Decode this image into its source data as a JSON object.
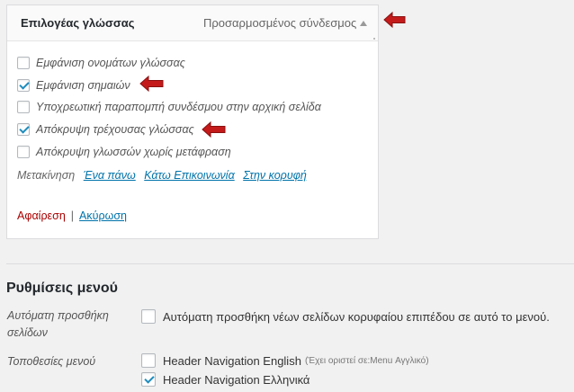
{
  "item": {
    "title": "Επιλογέας γλώσσας",
    "type_label": "Προσαρμοσμένος σύνδεσμος",
    "options": [
      {
        "label": "Εμφάνιση ονομάτων γλώσσας",
        "checked": false
      },
      {
        "label": "Εμφάνιση σημαιών",
        "checked": true
      },
      {
        "label": "Υποχρεωτική παραπομπή συνδέσμου στην αρχική σελίδα",
        "checked": false
      },
      {
        "label": "Απόκρυψη τρέχουσας γλώσσας",
        "checked": true
      },
      {
        "label": "Απόκρυψη γλωσσών χωρίς μετάφραση",
        "checked": false
      }
    ],
    "move_label": "Μετακίνηση",
    "move_up": "Ένα πάνω",
    "move_under": "Κάτω Επικοινωνία",
    "move_top": "Στην κορυφή",
    "remove_label": "Αφαίρεση",
    "separator": "|",
    "cancel_label": "Ακύρωση"
  },
  "menu_settings": {
    "title": "Ρυθμίσεις μενού",
    "auto_add_label": "Αυτόματη προσθήκη σελίδων",
    "auto_add_option": "Αυτόματη προσθήκη νέων σελίδων κορυφαίου επιπέδου σε αυτό το μενού.",
    "auto_add_checked": false,
    "locations_label": "Τοποθεσίες μενού",
    "locations": [
      {
        "label": "Header Navigation English",
        "note": "(Έχει οριστεί σε:Menu Αγγλικό)",
        "checked": false
      },
      {
        "label": "Header Navigation Ελληνικά",
        "note": "",
        "checked": true
      }
    ]
  },
  "colors": {
    "accent_link": "#0073aa",
    "remove_red": "#aa0000",
    "check_blue": "#1e8cbe",
    "annotation_arrow": "#c41a1a"
  },
  "icons": {
    "toggle": "arrow-up-triangle-icon",
    "annotation": "red-arrow-icon",
    "checkbox_checked": "checkmark-icon"
  }
}
